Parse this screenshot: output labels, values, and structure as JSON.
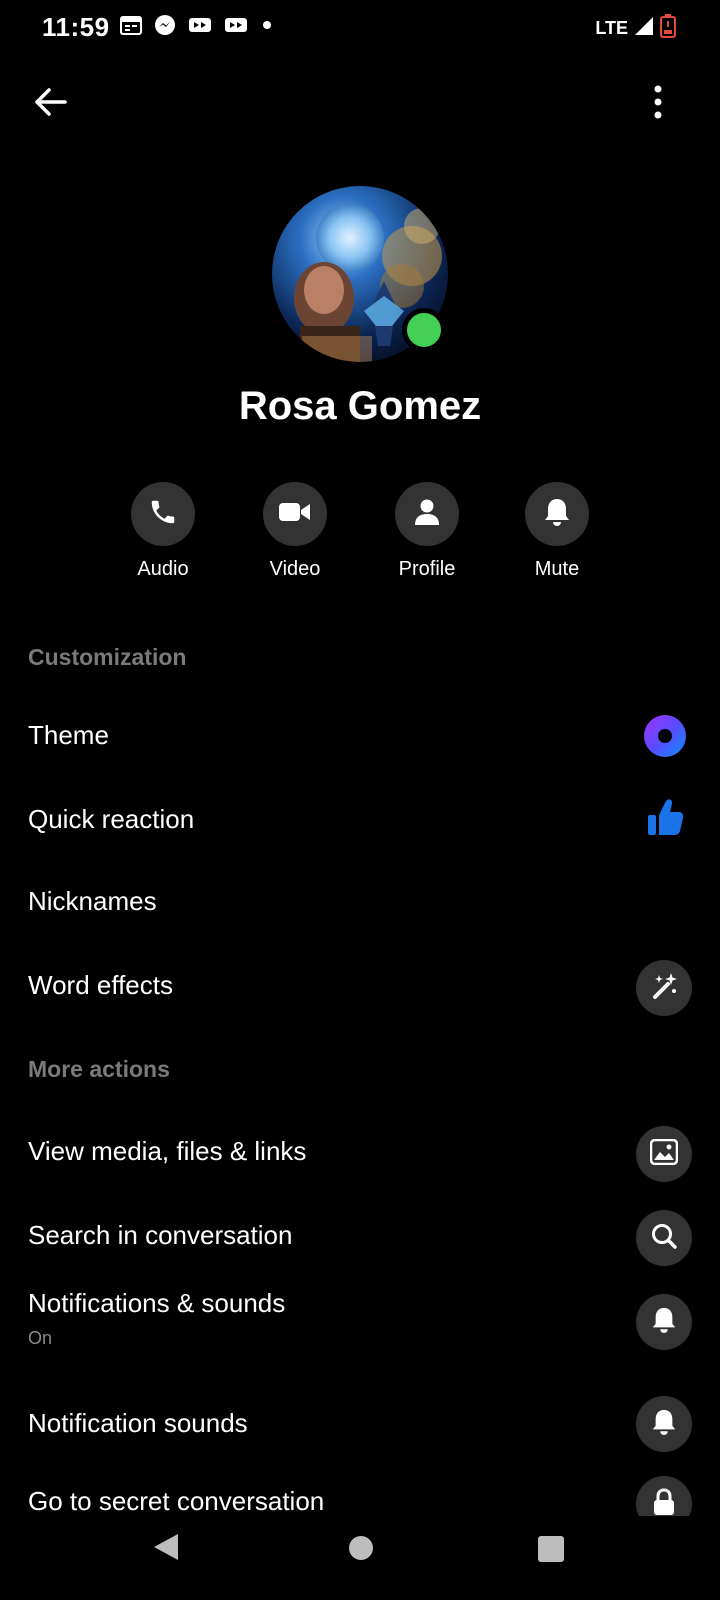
{
  "status_bar": {
    "time": "11:59",
    "network": "LTE",
    "left_icons": [
      "calendar-icon",
      "messenger-icon",
      "video-icon",
      "video-icon",
      "dot-icon"
    ],
    "right_icons": [
      "signal-icon",
      "battery-low-icon"
    ]
  },
  "header": {
    "back_icon": "arrow-left-icon",
    "more_icon": "more-vertical-icon"
  },
  "profile": {
    "name": "Rosa Gomez",
    "online": true,
    "online_color": "#44cf55"
  },
  "actions": [
    {
      "label": "Audio",
      "icon": "phone-icon"
    },
    {
      "label": "Video",
      "icon": "video-camera-icon"
    },
    {
      "label": "Profile",
      "icon": "person-icon"
    },
    {
      "label": "Mute",
      "icon": "bell-icon"
    }
  ],
  "customization": {
    "title": "Customization",
    "items": [
      {
        "label": "Theme",
        "icon": "theme-gradient-icon"
      },
      {
        "label": "Quick reaction",
        "icon": "thumbs-up-icon",
        "color": "#1a73e8"
      },
      {
        "label": "Nicknames"
      },
      {
        "label": "Word effects",
        "icon": "magic-wand-icon"
      }
    ]
  },
  "more_actions": {
    "title": "More actions",
    "items": [
      {
        "label": "View media, files & links",
        "icon": "image-icon"
      },
      {
        "label": "Search in conversation",
        "icon": "search-icon"
      },
      {
        "label": "Notifications & sounds",
        "sub": "On",
        "icon": "bell-icon"
      },
      {
        "label": "Notification sounds",
        "icon": "bell-icon"
      },
      {
        "label": "Go to secret conversation",
        "icon": "lock-icon"
      }
    ]
  },
  "nav_bar": {
    "back_icon": "nav-back-icon",
    "home_icon": "nav-home-icon",
    "recents_icon": "nav-recents-icon"
  },
  "colors": {
    "background": "#000000",
    "circle_bg": "#333333",
    "section_title": "#7a7a7a",
    "accent_blue": "#1a73e8"
  }
}
